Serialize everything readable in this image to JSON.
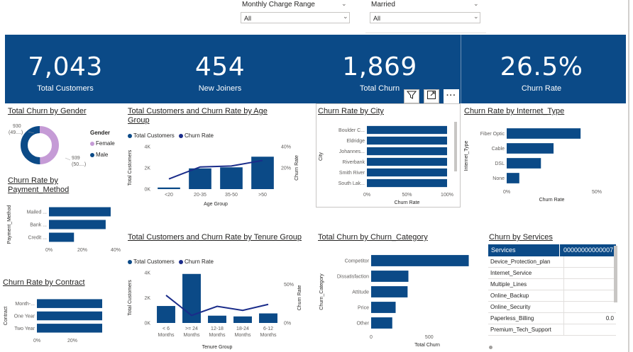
{
  "slicers": {
    "monthly_charge": {
      "title": "Monthly Charge Range",
      "value": "All"
    },
    "married": {
      "title": "Married",
      "value": "All"
    }
  },
  "kpis": [
    {
      "value": "7,043",
      "label": "Total Customers"
    },
    {
      "value": "454",
      "label": "New Joiners"
    },
    {
      "value": "1,869",
      "label": "Total Churn"
    },
    {
      "value": "26.5%",
      "label": "Churn Rate"
    }
  ],
  "colors": {
    "primary": "#0b4a87",
    "line": "#1a2c8a",
    "female": "#c59bd6",
    "band": "#0b4a87"
  },
  "visual_toolbar": {
    "filter_icon": "filter-icon",
    "focus_icon": "focus-mode-icon",
    "more_icon": "more-options-icon"
  },
  "titles": {
    "gender": "Total Churn by Gender",
    "age": "Total Customers and Churn Rate by Age Group",
    "city": "Churn Rate by City",
    "internet": "Churn Rate by Internet_Type",
    "payment": "Churn Rate by Payment_Method",
    "tenure": "Total Customers and Churn Rate by Tenure Group",
    "category": "Total Churn by Churn_Category",
    "services": "Churn by Services",
    "contract": "Churn Rate by Contract"
  },
  "gender": {
    "legend_title": "Gender",
    "female_label": "Female",
    "male_label": "Male",
    "label_top": "930",
    "label_top2": "(49....)",
    "label_bottom": "939",
    "label_bottom2": "(50....)",
    "female_value": 930,
    "male_value": 939
  },
  "age": {
    "legend_bar": "Total Customers",
    "legend_line": "Churn Rate",
    "ytitle": "Total Customers",
    "y2title": "Churn Rate",
    "xtitle": "Age Group",
    "yticks": [
      "4K",
      "2K",
      "0K"
    ],
    "y2ticks": [
      "40%",
      "20%"
    ],
    "categories": [
      "<20",
      "20-35",
      "35-50",
      ">50"
    ],
    "bars": [
      150,
      1950,
      2050,
      3050
    ],
    "line": [
      0.11,
      0.24,
      0.25,
      0.31
    ]
  },
  "city": {
    "ytitle": "City",
    "xtitle": "Churn Rate",
    "categories": [
      "Boulder C...",
      "Eldridge",
      "Johannes...",
      "Riverbank",
      "Smith River",
      "South Lak..."
    ],
    "values": [
      1.0,
      1.0,
      1.0,
      1.0,
      1.0,
      1.0
    ],
    "xticks": [
      "0%",
      "50%",
      "100%"
    ]
  },
  "internet": {
    "ytitle": "Internet_Type",
    "xtitle": "Churn Rate",
    "categories": [
      "Fiber Optic",
      "Cable",
      "DSL",
      "None"
    ],
    "values": [
      0.41,
      0.26,
      0.19,
      0.07
    ],
    "xticks": [
      "0%",
      "50%"
    ]
  },
  "payment": {
    "ytitle": "Payment_Method",
    "categories": [
      "Mailed ...",
      "Bank ...",
      "Credit ..."
    ],
    "values": [
      0.37,
      0.34,
      0.15
    ],
    "xticks": [
      "0%",
      "20%",
      "40%"
    ]
  },
  "tenure": {
    "legend_bar": "Total Customers",
    "legend_line": "Churn Rate",
    "ytitle": "Total Customers",
    "y2title": "Churn Rate",
    "xtitle": "Tenure Group",
    "yticks": [
      "4K",
      "2K",
      "0K"
    ],
    "y2ticks": [
      "50%",
      "0%"
    ],
    "categories": [
      [
        "< 6",
        "Months"
      ],
      [
        ">= 24",
        "Months"
      ],
      [
        "12-18",
        "Months"
      ],
      [
        "18-24",
        "Months"
      ],
      [
        "6-12",
        "Months"
      ]
    ],
    "bars": [
      1350,
      3900,
      580,
      520,
      760
    ],
    "line": [
      0.55,
      0.15,
      0.33,
      0.25,
      0.37
    ]
  },
  "category": {
    "ytitle": "Churn_Category",
    "xtitle": "Total Churn",
    "categories": [
      "Competitor",
      "Dissatisfaction",
      "Attitude",
      "Price",
      "Other"
    ],
    "values": [
      841,
      321,
      314,
      211,
      182
    ],
    "xticks": [
      "0",
      "500"
    ]
  },
  "services": {
    "col_header": "Services",
    "col_value": "00000000000007",
    "rows": [
      {
        "name": "Device_Protection_plan",
        "value": ""
      },
      {
        "name": "Internet_Service",
        "value": ""
      },
      {
        "name": "Multiple_Lines",
        "value": ""
      },
      {
        "name": "Online_Backup",
        "value": ""
      },
      {
        "name": "Online_Security",
        "value": ""
      },
      {
        "name": "Paperless_Billing",
        "value": "0.0"
      },
      {
        "name": "Premium_Tech_Support",
        "value": ""
      }
    ]
  },
  "contract": {
    "ytitle": "Contract",
    "categories": [
      "Month-...",
      "One Year",
      "Two Year"
    ],
    "values": [
      0.46,
      0.46,
      0.46
    ],
    "xticks": [
      "0%",
      "20%"
    ]
  }
}
